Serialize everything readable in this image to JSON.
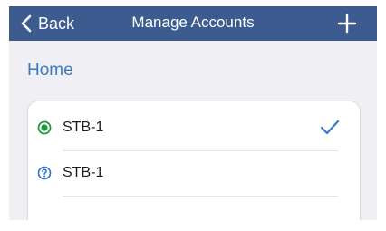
{
  "navbar": {
    "back_label": "Back",
    "title": "Manage Accounts",
    "add_icon": "plus-icon",
    "back_icon": "chevron-left-icon",
    "background_color": "#3c5c8f"
  },
  "section": {
    "title": "Home",
    "title_color": "#3a79c6"
  },
  "accounts": [
    {
      "label": "STB-1",
      "status_icon": "online-status-icon",
      "status_color": "#1f9a3a",
      "selected": true
    },
    {
      "label": "STB-1",
      "status_icon": "unknown-status-icon",
      "status_color": "#2f6fd0",
      "selected": false
    }
  ],
  "checkmark_color": "#3a79c6"
}
